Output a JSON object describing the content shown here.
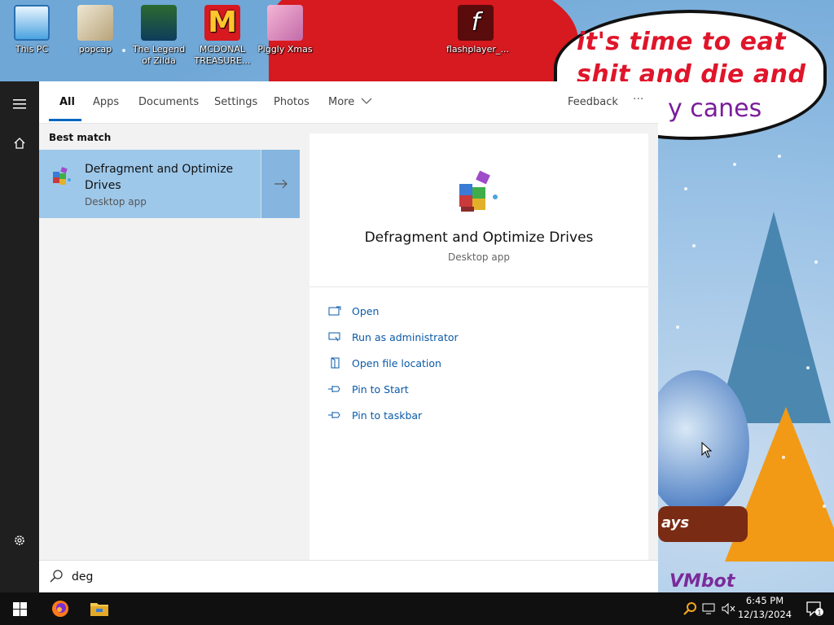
{
  "desktop": {
    "icons": [
      {
        "label": "This PC",
        "icon": "this-pc-icon"
      },
      {
        "label": "popcap",
        "icon": "folder-icon"
      },
      {
        "label": "The Legend of Zilda",
        "icon": "game-shortcut-icon"
      },
      {
        "label": "MCDONAL TREASURE...",
        "icon": "mcdonalds-shortcut-icon"
      },
      {
        "label": "Piggly Xmas",
        "icon": "pig-shortcut-icon"
      },
      {
        "label": "flashplayer_...",
        "icon": "flash-player-icon"
      }
    ],
    "wallpaper": {
      "speech_text": "it's time to eat shit and die and chew",
      "speech_text_cont": "y canes",
      "banner_text": "ays",
      "watermark": "VMbot"
    }
  },
  "search_panel": {
    "tabs": [
      "All",
      "Apps",
      "Documents",
      "Settings",
      "Photos",
      "More"
    ],
    "active_tab": "All",
    "feedback_label": "Feedback",
    "more_options_label": "···",
    "best_match_label": "Best match",
    "result": {
      "title": "Defragment and Optimize Drives",
      "subtitle": "Desktop app"
    },
    "detail": {
      "title": "Defragment and Optimize Drives",
      "subtitle": "Desktop app",
      "actions": [
        {
          "label": "Open",
          "icon": "open-icon"
        },
        {
          "label": "Run as administrator",
          "icon": "run-as-admin-icon"
        },
        {
          "label": "Open file location",
          "icon": "file-location-icon"
        },
        {
          "label": "Pin to Start",
          "icon": "pin-icon"
        },
        {
          "label": "Pin to taskbar",
          "icon": "pin-icon"
        }
      ]
    },
    "search_value": "deg"
  },
  "taskbar": {
    "clock_time": "6:45 PM",
    "clock_date": "12/13/2024"
  },
  "colors": {
    "accent": "#0067c0",
    "selection": "#9ec8ea",
    "rail": "#1f1f1f",
    "taskbar": "#101010"
  }
}
